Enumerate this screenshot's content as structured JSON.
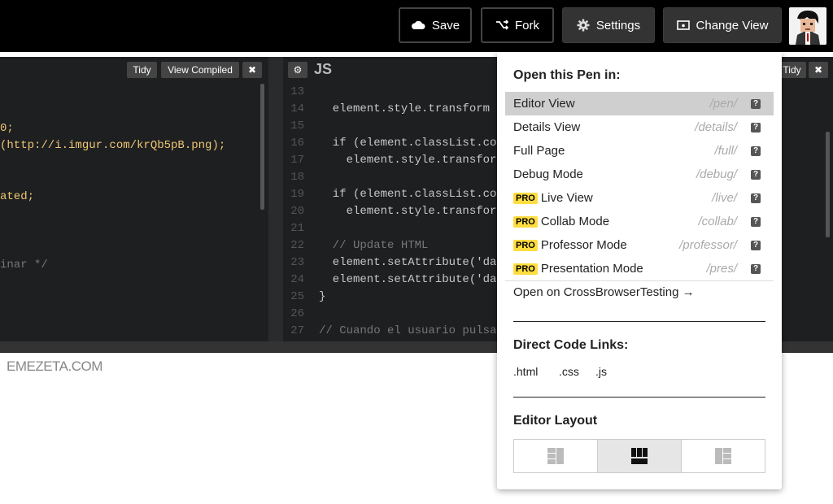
{
  "topbar": {
    "save": "Save",
    "fork": "Fork",
    "settings": "Settings",
    "change_view": "Change View"
  },
  "left_pane": {
    "tidy": "Tidy",
    "view_compiled": "View Compiled",
    "close": "✖",
    "lines": [
      {
        "text": "",
        "color": "#ccc"
      },
      {
        "text": "",
        "color": "#ccc"
      },
      {
        "text": "0;",
        "color": "#f0c674"
      },
      {
        "text": "(http://i.imgur.com/krQb5pB.png);",
        "color": "#f0c674"
      },
      {
        "text": "",
        "color": "#ccc"
      },
      {
        "text": "",
        "color": "#ccc"
      },
      {
        "text": "ated;",
        "color": "#f0c674"
      },
      {
        "text": "",
        "color": "#ccc"
      },
      {
        "text": "",
        "color": "#ccc"
      },
      {
        "text": "",
        "color": "#ccc"
      },
      {
        "text": "inar */",
        "color": "#777"
      }
    ]
  },
  "right_pane": {
    "gear": "⚙",
    "lang": "JS",
    "tidy": "Tidy",
    "close": "✖",
    "line_numbers": [
      "13",
      "14",
      "15",
      "16",
      "17",
      "18",
      "19",
      "20",
      "21",
      "22",
      "23",
      "24",
      "25",
      "26",
      "27"
    ],
    "lines": [
      "",
      "  element.style.transform",
      "",
      "  if (element.classList.co",
      "    element.style.transfor",
      "",
      "  if (element.classList.co",
      "    element.style.transfor",
      "",
      "  // Update HTML",
      "  element.setAttribute('da",
      "  element.setAttribute('da",
      "}",
      "",
      "// Cuando el usuario pulsa"
    ]
  },
  "watermark": "EMEZETA.COM",
  "menu": {
    "open_title": "Open this Pen in:",
    "items": [
      {
        "label": "Editor View",
        "path": "/pen/",
        "pro": false,
        "active": true
      },
      {
        "label": "Details View",
        "path": "/details/",
        "pro": false,
        "active": false
      },
      {
        "label": "Full Page",
        "path": "/full/",
        "pro": false,
        "active": false
      },
      {
        "label": "Debug Mode",
        "path": "/debug/",
        "pro": false,
        "active": false
      },
      {
        "label": "Live View",
        "path": "/live/",
        "pro": true,
        "active": false
      },
      {
        "label": "Collab Mode",
        "path": "/collab/",
        "pro": true,
        "active": false
      },
      {
        "label": "Professor Mode",
        "path": "/professor/",
        "pro": true,
        "active": false
      },
      {
        "label": "Presentation Mode",
        "path": "/pres/",
        "pro": true,
        "active": false
      }
    ],
    "pro_badge": "PRO",
    "help": "?",
    "crossbrowser": "Open on CrossBrowserTesting →",
    "direct_title": "Direct Code Links:",
    "links": [
      ".html",
      ".css",
      ".js"
    ],
    "layout_title": "Editor Layout"
  }
}
